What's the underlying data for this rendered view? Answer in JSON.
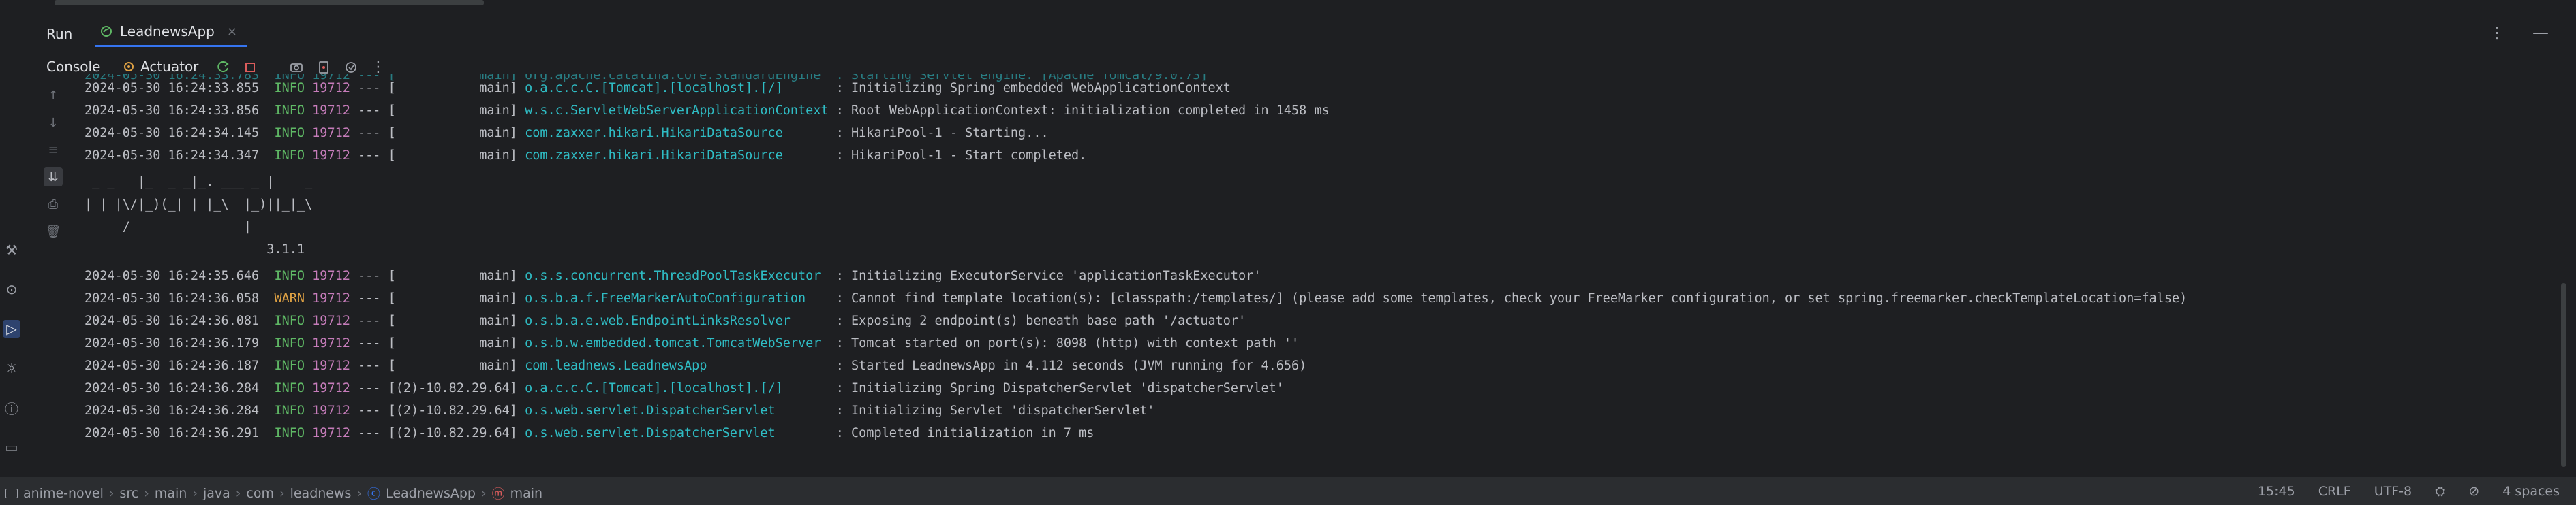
{
  "tool_window": {
    "title": "Run"
  },
  "run_tab": {
    "label": "LeadnewsApp",
    "close": "×"
  },
  "console_tabs": {
    "console": "Console",
    "actuator": "Actuator"
  },
  "log_lines": [
    {
      "ts": "2024-05-30 16:24:33.855",
      "level": "INFO",
      "pid": "19712",
      "sep": "---",
      "thread": "[           main]",
      "logger": "o.a.c.c.C.[Tomcat].[localhost].[/]      ",
      "msg": ": Initializing Spring embedded WebApplicationContext"
    },
    {
      "ts": "2024-05-30 16:24:33.856",
      "level": "INFO",
      "pid": "19712",
      "sep": "---",
      "thread": "[           main]",
      "logger": "w.s.c.ServletWebServerApplicationContext",
      "msg": ": Root WebApplicationContext: initialization completed in 1458 ms"
    },
    {
      "ts": "2024-05-30 16:24:34.145",
      "level": "INFO",
      "pid": "19712",
      "sep": "---",
      "thread": "[           main]",
      "logger": "com.zaxxer.hikari.HikariDataSource      ",
      "msg": ": HikariPool-1 - Starting..."
    },
    {
      "ts": "2024-05-30 16:24:34.347",
      "level": "INFO",
      "pid": "19712",
      "sep": "---",
      "thread": "[           main]",
      "logger": "com.zaxxer.hikari.HikariDataSource      ",
      "msg": ": HikariPool-1 - Start completed."
    }
  ],
  "banner": [
    " _ _   |_  _ _|_. ___ _ |    _",
    "| | |\\/|_)(_| | |_\\  |_)||_|_\\",
    "     /               |",
    "                        3.1.1"
  ],
  "log_lines_2": [
    {
      "ts": "2024-05-30 16:24:35.646",
      "level": "INFO",
      "pid": "19712",
      "sep": "---",
      "thread": "[           main]",
      "logger": "o.s.s.concurrent.ThreadPoolTaskExecutor ",
      "msg": ": Initializing ExecutorService 'applicationTaskExecutor'"
    },
    {
      "ts": "2024-05-30 16:24:36.058",
      "level": "WARN",
      "pid": "19712",
      "sep": "---",
      "thread": "[           main]",
      "logger": "o.s.b.a.f.FreeMarkerAutoConfiguration   ",
      "msg": ": Cannot find template location(s): [classpath:/templates/] (please add some templates, check your FreeMarker configuration, or set spring.freemarker.checkTemplateLocation=false)"
    },
    {
      "ts": "2024-05-30 16:24:36.081",
      "level": "INFO",
      "pid": "19712",
      "sep": "---",
      "thread": "[           main]",
      "logger": "o.s.b.a.e.web.EndpointLinksResolver     ",
      "msg": ": Exposing 2 endpoint(s) beneath base path '/actuator'"
    },
    {
      "ts": "2024-05-30 16:24:36.179",
      "level": "INFO",
      "pid": "19712",
      "sep": "---",
      "thread": "[           main]",
      "logger": "o.s.b.w.embedded.tomcat.TomcatWebServer ",
      "msg": ": Tomcat started on port(s): 8098 (http) with context path ''"
    },
    {
      "ts": "2024-05-30 16:24:36.187",
      "level": "INFO",
      "pid": "19712",
      "sep": "---",
      "thread": "[           main]",
      "logger": "com.leadnews.LeadnewsApp                ",
      "msg": ": Started LeadnewsApp in 4.112 seconds (JVM running for 4.656)"
    },
    {
      "ts": "2024-05-30 16:24:36.284",
      "level": "INFO",
      "pid": "19712",
      "sep": "---",
      "thread": "[(2)-10.82.29.64]",
      "logger": "o.a.c.c.C.[Tomcat].[localhost].[/]      ",
      "msg": ": Initializing Spring DispatcherServlet 'dispatcherServlet'"
    },
    {
      "ts": "2024-05-30 16:24:36.284",
      "level": "INFO",
      "pid": "19712",
      "sep": "---",
      "thread": "[(2)-10.82.29.64]",
      "logger": "o.s.web.servlet.DispatcherServlet       ",
      "msg": ": Initializing Servlet 'dispatcherServlet'"
    },
    {
      "ts": "2024-05-30 16:24:36.291",
      "level": "INFO",
      "pid": "19712",
      "sep": "---",
      "thread": "[(2)-10.82.29.64]",
      "logger": "o.s.web.servlet.DispatcherServlet       ",
      "msg": ": Completed initialization in 7 ms"
    }
  ],
  "breadcrumb": [
    "anime-novel",
    "src",
    "main",
    "java",
    "com",
    "leadnews",
    "LeadnewsApp",
    "main"
  ],
  "status": {
    "position": "15:45",
    "line_sep": "CRLF",
    "encoding": "UTF-8",
    "indent": "4 spaces"
  },
  "colors": {
    "info": "#5fb865",
    "warn": "#e0a244",
    "pid": "#c77dbb",
    "logger": "#2fbcc4",
    "accent": "#3574f0"
  }
}
